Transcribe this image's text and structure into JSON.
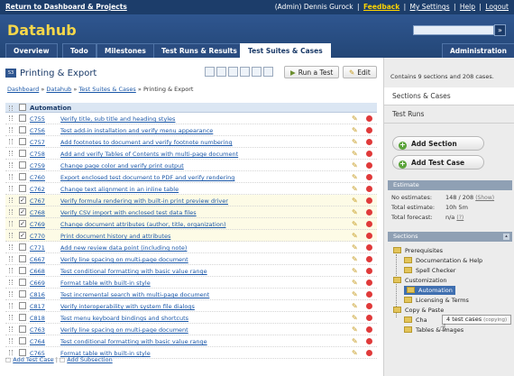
{
  "topbar": {
    "return_link": "Return to Dashboard & Projects",
    "user": "(Admin) Dennis Gurock",
    "feedback": "Feedback",
    "my_settings": "My Settings",
    "help": "Help",
    "logout": "Logout",
    "sep": "|"
  },
  "header": {
    "logo": "Datahub",
    "search_button": "»",
    "tabs": [
      "Overview",
      "Todo",
      "Milestones",
      "Test Runs & Results",
      "Test Suites & Cases"
    ],
    "admin_tab": "Administration"
  },
  "page": {
    "icon_text": "S3",
    "title": "Printing & Export",
    "run_button": "Run a Test",
    "edit_button": "Edit",
    "breadcrumb": [
      "Dashboard",
      "Datahub",
      "Test Suites & Cases",
      "Printing & Export"
    ],
    "breadcrumb_sep": "»"
  },
  "grid": {
    "section_name": "Automation",
    "rows": [
      {
        "id": "C755",
        "title": "Verify title, sub title and heading styles",
        "checked": false
      },
      {
        "id": "C756",
        "title": "Test add-in installation and verify menu appearance",
        "checked": false
      },
      {
        "id": "C757",
        "title": "Add footnotes to document and verify footnote numbering",
        "checked": false
      },
      {
        "id": "C758",
        "title": "Add and verify Tables of Contents with multi-page document",
        "checked": false
      },
      {
        "id": "C759",
        "title": "Change page color and verify print output",
        "checked": false
      },
      {
        "id": "C760",
        "title": "Export enclosed test document to PDF and verify rendering",
        "checked": false
      },
      {
        "id": "C762",
        "title": "Change text alignment in an inline table",
        "checked": false
      },
      {
        "id": "C767",
        "title": "Verify formula rendering with built-in print preview driver",
        "checked": true
      },
      {
        "id": "C768",
        "title": "Verify CSV import with enclosed test data files",
        "checked": true
      },
      {
        "id": "C769",
        "title": "Change document attributes (author, title, organization)",
        "checked": true
      },
      {
        "id": "C770",
        "title": "Print document history and attributes",
        "checked": true
      },
      {
        "id": "C771",
        "title": "Add new review data point (including note)",
        "checked": false
      },
      {
        "id": "C667",
        "title": "Verify line spacing on multi-page document",
        "checked": false
      },
      {
        "id": "C668",
        "title": "Test conditional formatting with basic value range",
        "checked": false
      },
      {
        "id": "C669",
        "title": "Format table with built-in style",
        "checked": false
      },
      {
        "id": "C816",
        "title": "Test incremental search with multi-page document",
        "checked": false
      },
      {
        "id": "C817",
        "title": "Verify interoperability with system file dialogs",
        "checked": false
      },
      {
        "id": "C818",
        "title": "Test menu keyboard bindings and shortcuts",
        "checked": false
      },
      {
        "id": "C763",
        "title": "Verify line spacing on multi-page document",
        "checked": false
      },
      {
        "id": "C764",
        "title": "Test conditional formatting with basic value range",
        "checked": false
      },
      {
        "id": "C765",
        "title": "Format table with built-in style",
        "checked": false
      }
    ],
    "add_test_case": "Add Test Case",
    "add_subsection": "Add Subsection",
    "link_sep": "|"
  },
  "sidebar": {
    "info": "Contains 9 sections and 208 cases.",
    "tab_sections": "Sections & Cases",
    "tab_runs": "Test Runs",
    "add_section": "Add Section",
    "add_test_case": "Add Test Case",
    "estimate_header": "Estimate",
    "no_estimates_label": "No estimates:",
    "no_estimates_value": "148 / 208",
    "show_link": "(Show)",
    "total_estimate_label": "Total estimate:",
    "total_estimate_value": "10h 5m",
    "total_forecast_label": "Total forecast:",
    "total_forecast_value": "n/a",
    "forecast_help": "(?)",
    "sections_header": "Sections",
    "tree": [
      "Prerequisites",
      "Documentation & Help",
      "Spell Checker",
      "Customization",
      "Automation",
      "Licensing & Terms",
      "Copy & Paste",
      "Cha",
      "Tables & Images"
    ],
    "tooltip_count": "4 test cases",
    "tooltip_mode": "(copying)"
  }
}
